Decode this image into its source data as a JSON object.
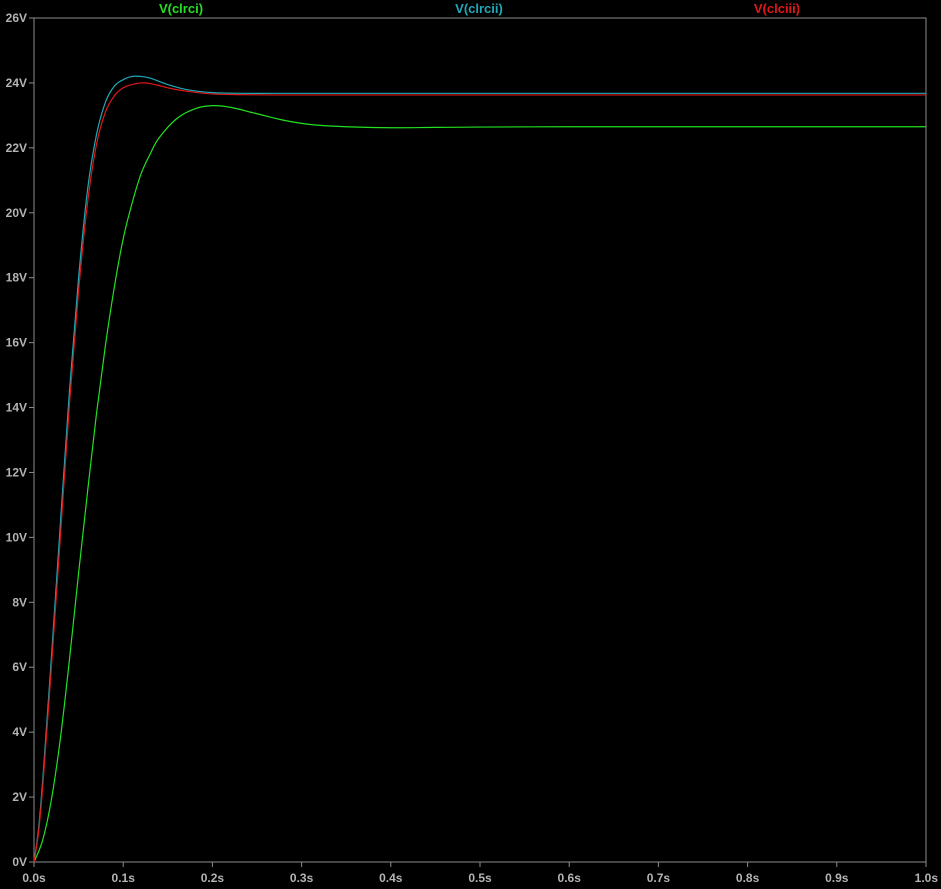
{
  "chart_data": {
    "type": "line",
    "title": "",
    "xlabel": "",
    "ylabel": "",
    "xlim": [
      0,
      1.0
    ],
    "ylim": [
      0,
      26
    ],
    "grid": false,
    "legend_position": "top",
    "background": "#000000",
    "axis_color": "#8c8c8c",
    "x_ticks": [
      {
        "value": 0.0,
        "label": "0.0s"
      },
      {
        "value": 0.1,
        "label": "0.1s"
      },
      {
        "value": 0.2,
        "label": "0.2s"
      },
      {
        "value": 0.3,
        "label": "0.3s"
      },
      {
        "value": 0.4,
        "label": "0.4s"
      },
      {
        "value": 0.5,
        "label": "0.5s"
      },
      {
        "value": 0.6,
        "label": "0.6s"
      },
      {
        "value": 0.7,
        "label": "0.7s"
      },
      {
        "value": 0.8,
        "label": "0.8s"
      },
      {
        "value": 0.9,
        "label": "0.9s"
      },
      {
        "value": 1.0,
        "label": "1.0s"
      }
    ],
    "y_ticks": [
      {
        "value": 0,
        "label": "0V"
      },
      {
        "value": 2,
        "label": "2V"
      },
      {
        "value": 4,
        "label": "4V"
      },
      {
        "value": 6,
        "label": "6V"
      },
      {
        "value": 8,
        "label": "8V"
      },
      {
        "value": 10,
        "label": "10V"
      },
      {
        "value": 12,
        "label": "12V"
      },
      {
        "value": 14,
        "label": "14V"
      },
      {
        "value": 16,
        "label": "16V"
      },
      {
        "value": 18,
        "label": "18V"
      },
      {
        "value": 20,
        "label": "20V"
      },
      {
        "value": 22,
        "label": "22V"
      },
      {
        "value": 24,
        "label": "24V"
      },
      {
        "value": 26,
        "label": "26V"
      }
    ],
    "series": [
      {
        "name": "V(clrci)",
        "color": "#22e022",
        "x": [
          0,
          0.01,
          0.02,
          0.03,
          0.04,
          0.05,
          0.06,
          0.07,
          0.08,
          0.09,
          0.1,
          0.11,
          0.12,
          0.13,
          0.14,
          0.16,
          0.18,
          0.2,
          0.22,
          0.25,
          0.28,
          0.31,
          0.35,
          0.4,
          0.45,
          0.5,
          0.6,
          0.7,
          0.8,
          0.9,
          1.0
        ],
        "y": [
          0,
          0.7,
          2.0,
          3.9,
          6.3,
          8.9,
          11.4,
          13.8,
          15.9,
          17.7,
          19.2,
          20.3,
          21.2,
          21.8,
          22.3,
          22.9,
          23.2,
          23.3,
          23.25,
          23.05,
          22.85,
          22.72,
          22.65,
          22.62,
          22.63,
          22.64,
          22.65,
          22.65,
          22.65,
          22.65,
          22.65
        ]
      },
      {
        "name": "V(clrcii)",
        "color": "#1fa9b8",
        "x": [
          0,
          0.005,
          0.01,
          0.02,
          0.03,
          0.04,
          0.05,
          0.06,
          0.07,
          0.08,
          0.09,
          0.1,
          0.11,
          0.12,
          0.13,
          0.14,
          0.15,
          0.17,
          0.2,
          0.23,
          0.27,
          0.3,
          0.4,
          0.5,
          0.6,
          0.7,
          0.8,
          0.9,
          1.0
        ],
        "y": [
          0,
          1.0,
          2.6,
          6.5,
          10.6,
          14.6,
          18.0,
          20.7,
          22.4,
          23.4,
          23.9,
          24.1,
          24.2,
          24.2,
          24.15,
          24.05,
          23.95,
          23.8,
          23.7,
          23.68,
          23.68,
          23.68,
          23.68,
          23.68,
          23.68,
          23.68,
          23.68,
          23.68,
          23.68
        ]
      },
      {
        "name": "V(clciii)",
        "color": "#e01818",
        "x": [
          0,
          0.005,
          0.01,
          0.02,
          0.03,
          0.04,
          0.05,
          0.06,
          0.07,
          0.08,
          0.09,
          0.1,
          0.11,
          0.12,
          0.13,
          0.14,
          0.15,
          0.17,
          0.2,
          0.23,
          0.27,
          0.3,
          0.4,
          0.5,
          0.6,
          0.7,
          0.8,
          0.9,
          1.0
        ],
        "y": [
          0,
          0.9,
          2.4,
          6.2,
          10.2,
          14.2,
          17.6,
          20.3,
          22.1,
          23.1,
          23.6,
          23.85,
          23.95,
          24.0,
          23.98,
          23.92,
          23.85,
          23.75,
          23.66,
          23.64,
          23.63,
          23.63,
          23.63,
          23.63,
          23.63,
          23.63,
          23.63,
          23.63,
          23.63
        ]
      }
    ]
  }
}
